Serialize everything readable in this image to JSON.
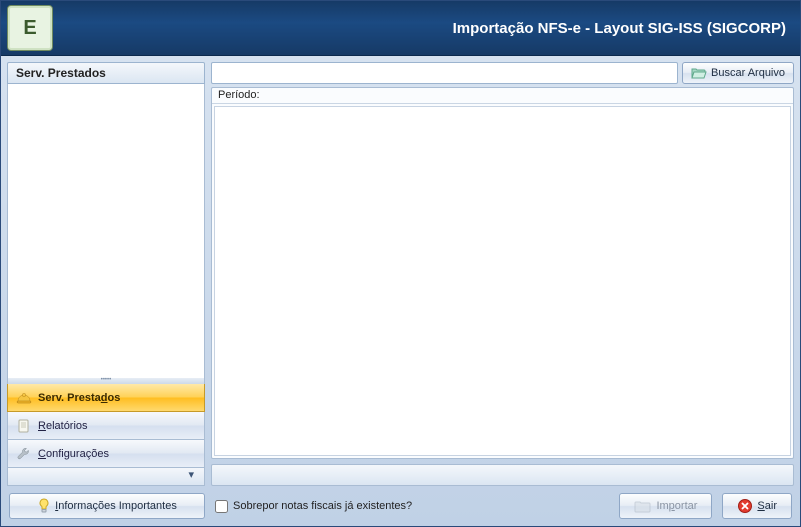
{
  "titlebar": {
    "title": "Importação NFS-e - Layout SIG-ISS (SIGCORP)",
    "logo_letter": "E"
  },
  "sidebar": {
    "header": "Serv. Prestados",
    "items": [
      {
        "label": "Serv. Prestados",
        "label_pre": "Serv. Presta",
        "label_u": "d",
        "label_post": "os",
        "active": true
      },
      {
        "label": "Relatórios",
        "label_pre": "",
        "label_u": "R",
        "label_post": "elatórios",
        "active": false
      },
      {
        "label": "Configurações",
        "label_pre": "",
        "label_u": "C",
        "label_post": "onfigurações",
        "active": false
      }
    ],
    "overflow_glyph": "▾"
  },
  "main": {
    "filepath_value": "",
    "browse_button": "Buscar Arquivo",
    "periodo_label": "Período:",
    "status_text": ""
  },
  "bottom": {
    "info_button_pre": "",
    "info_button_u": "I",
    "info_button_post": "nformações Importantes",
    "overwrite_label": "Sobrepor notas fiscais já existentes?",
    "overwrite_checked": false,
    "import_button_pre": "Im",
    "import_button_u": "p",
    "import_button_post": "ortar",
    "exit_button_pre": "",
    "exit_button_u": "S",
    "exit_button_post": "air"
  }
}
